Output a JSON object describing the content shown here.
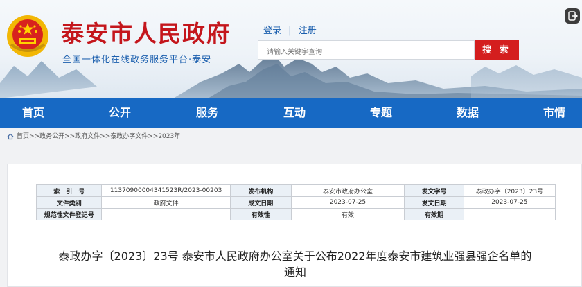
{
  "header": {
    "title": "泰安市人民政府",
    "subtitle": "全国一体化在线政务服务平台·泰安",
    "login": "登录",
    "divider": "|",
    "register": "注册",
    "search_placeholder": "请输入关键字查询",
    "search_button": "搜 索"
  },
  "nav": [
    "首页",
    "公开",
    "服务",
    "互动",
    "专题",
    "数据",
    "市情"
  ],
  "breadcrumb": "首页>>政务公开>>政府文件>>泰政办字文件>>2023年",
  "meta": {
    "rows": [
      [
        "索　引　号",
        "11370900004341523R/2023-00203",
        "发布机构",
        "泰安市政府办公室",
        "发文字号",
        "泰政办字〔2023〕23号"
      ],
      [
        "文件类别",
        "政府文件",
        "成文日期",
        "2023-07-25",
        "发文日期",
        "2023-07-25"
      ],
      [
        "规范性文件登记号",
        "",
        "有效性",
        "有效",
        "有效期",
        ""
      ]
    ]
  },
  "document": {
    "title_line1": "泰政办字〔2023〕23号 泰安市人民政府办公室关于公布2022年度泰安市建筑业强县强企名单的",
    "title_line2": "通知"
  },
  "colors": {
    "brand_red": "#c4161c",
    "nav_blue": "#1769c4",
    "search_red": "#d41e1e",
    "label_bg": "#eaf0f6"
  },
  "icons": [
    "national-emblem-icon",
    "home-icon",
    "exit-icon"
  ]
}
